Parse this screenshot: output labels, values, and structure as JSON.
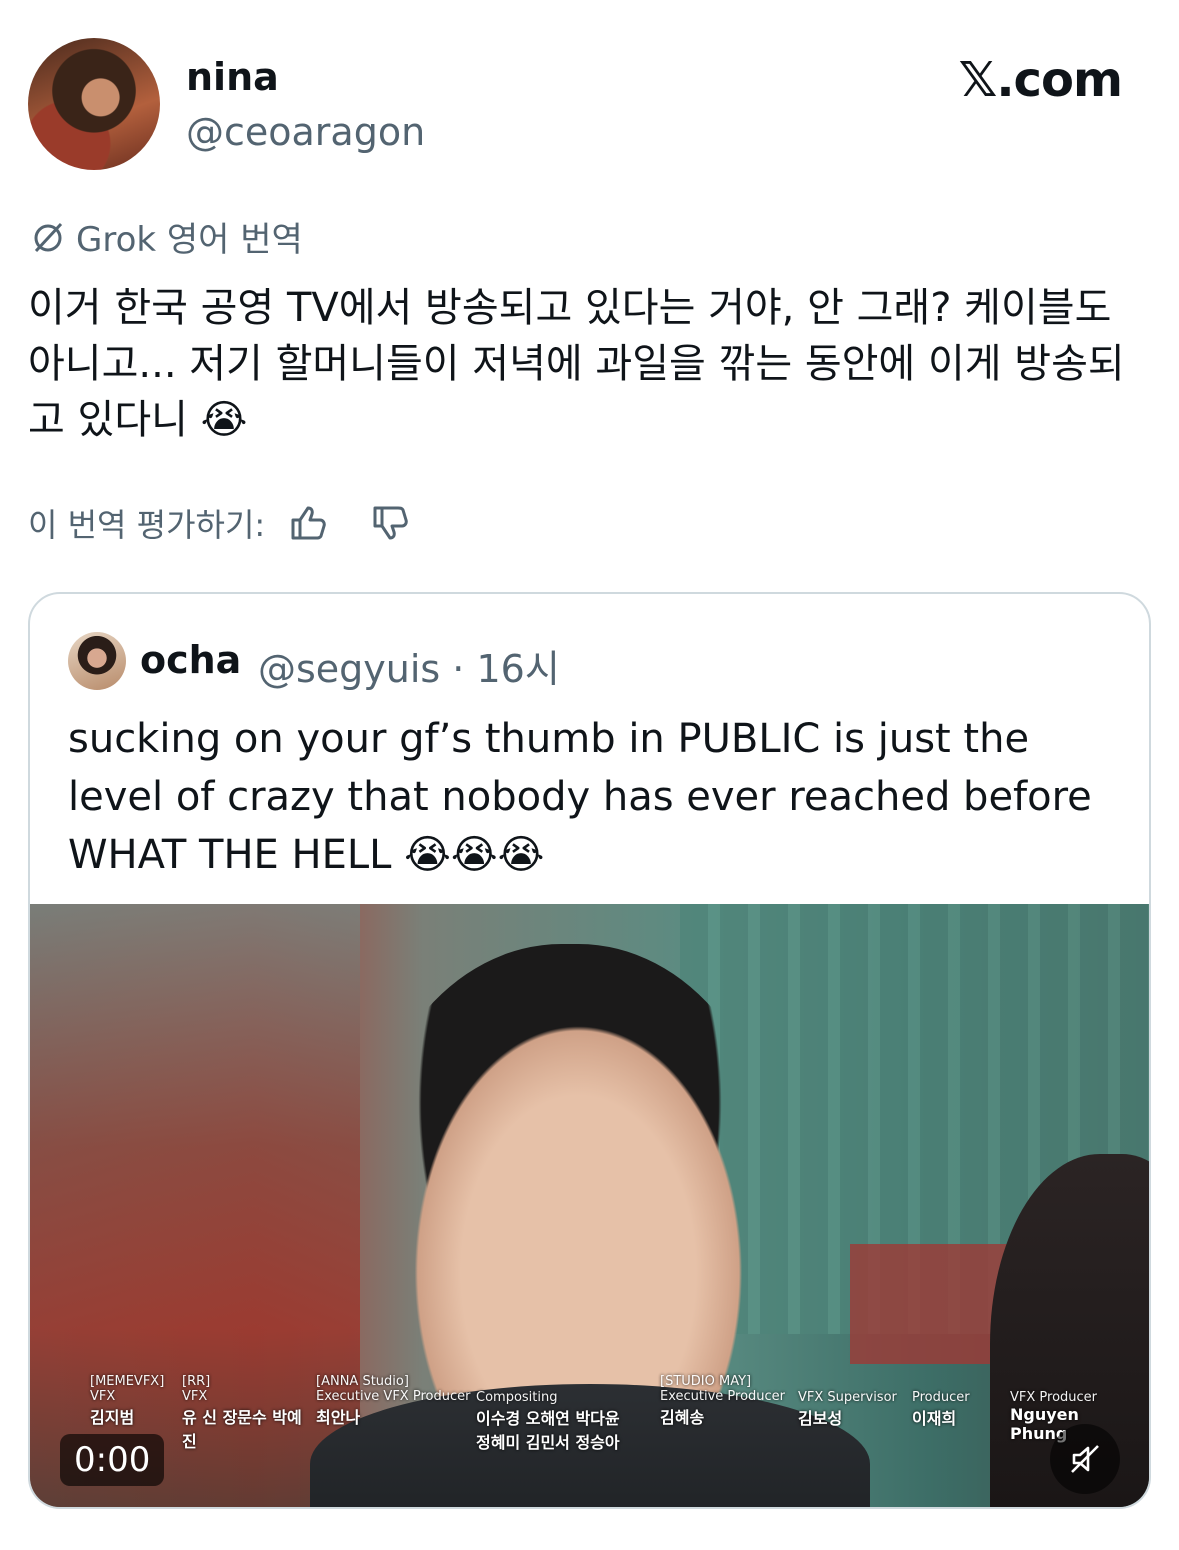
{
  "tweet": {
    "author_name": "nina",
    "author_handle": "@ceoaragon",
    "site_label": "𝕏.com",
    "translation_label": "Grok 영어 번역",
    "translated_text": "이거 한국 공영 TV에서 방송되고 있다는 거야, 안 그래? 케이블도 아니고... 저기 할머니들이 저녁에 과일을 깎는 동안에 이게 방송되고 있다니 😭",
    "rate_label": "이 번역 평가하기:"
  },
  "quote": {
    "author_name": "ocha",
    "author_handle": "@segyuis · 16시",
    "text": "sucking on your gf’s thumb in PUBLIC is just the level of crazy that nobody has ever reached before WHAT THE HELL 😭😭😭",
    "video": {
      "timecode": "0:00",
      "credits": [
        {
          "title": "[MEMEVFX]",
          "role": "VFX",
          "names": "김지범"
        },
        {
          "title": "[RR]",
          "role": "VFX",
          "names": "유 신 장문수 박예진"
        },
        {
          "title": "[ANNA Studio]",
          "role": "Executive VFX Producer",
          "names": "최안나"
        },
        {
          "title": "",
          "role": "Compositing",
          "names": "이수경 오해연 박다윤 정혜미 김민서 정승아"
        },
        {
          "title": "[STUDIO MAY]",
          "role": "Executive Producer",
          "names": "김혜송"
        },
        {
          "title": "",
          "role": "VFX Supervisor",
          "names": "김보성"
        },
        {
          "title": "",
          "role": "Producer",
          "names": "이재희"
        },
        {
          "title": "",
          "role": "VFX Producer",
          "names": "Nguyen Phung"
        }
      ]
    }
  },
  "icons": {
    "grok": "grok-icon",
    "thumbs_up": "thumbs-up-icon",
    "thumbs_down": "thumbs-down-icon",
    "mute": "muted-speaker-icon"
  },
  "colors": {
    "text": "#0f1419",
    "secondary": "#536471",
    "border": "#cfd9de"
  }
}
